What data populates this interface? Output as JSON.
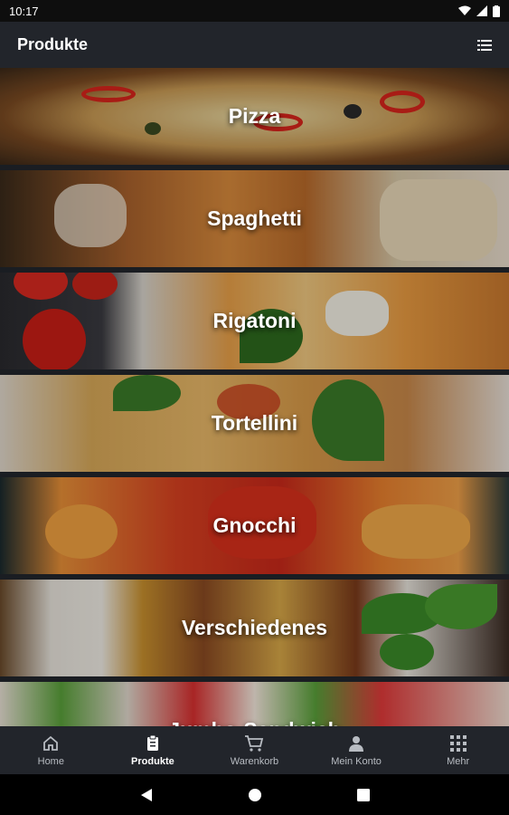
{
  "status_bar": {
    "time": "10:17"
  },
  "app_bar": {
    "title": "Produkte",
    "menu_icon": "list-icon"
  },
  "categories": [
    {
      "label": "Pizza"
    },
    {
      "label": "Spaghetti"
    },
    {
      "label": "Rigatoni"
    },
    {
      "label": "Tortellini"
    },
    {
      "label": "Gnocchi"
    },
    {
      "label": "Verschiedenes"
    },
    {
      "label": "Jumbo-Sandwich"
    }
  ],
  "bottom_nav": {
    "items": [
      {
        "label": "Home",
        "icon": "home-icon"
      },
      {
        "label": "Produkte",
        "icon": "clipboard-icon",
        "active": true
      },
      {
        "label": "Warenkorb",
        "icon": "cart-icon"
      },
      {
        "label": "Mein Konto",
        "icon": "person-icon"
      },
      {
        "label": "Mehr",
        "icon": "grid-icon"
      }
    ]
  },
  "colors": {
    "app_bar": "#22252b",
    "nav_active": "#ffffff",
    "nav_inactive": "#b8bcc2"
  }
}
